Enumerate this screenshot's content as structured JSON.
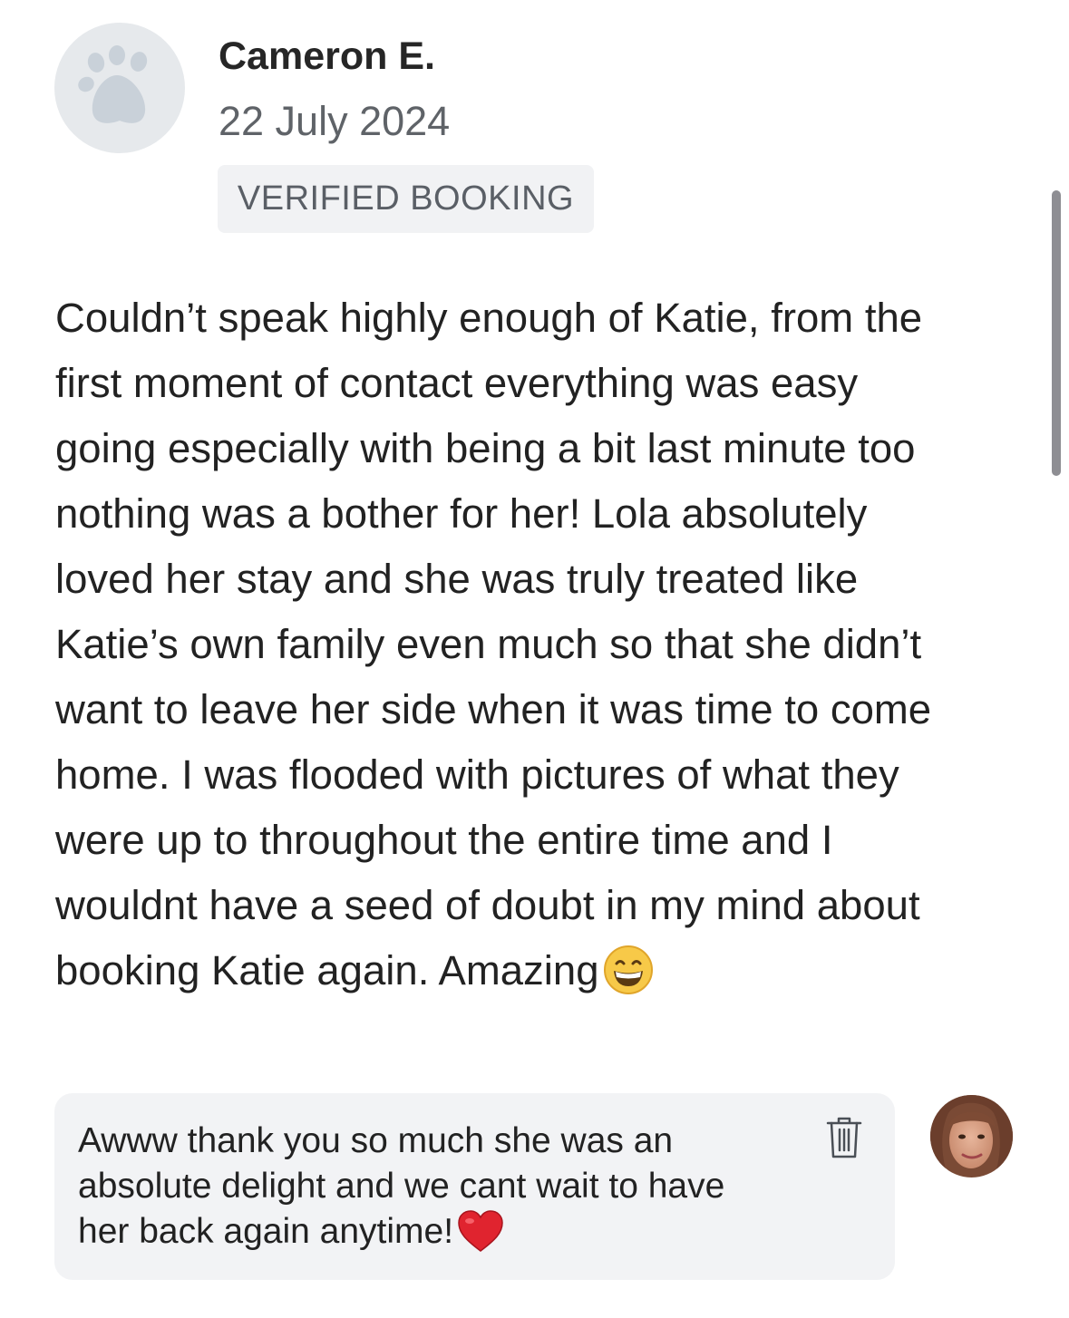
{
  "review": {
    "reviewer_name": "Cameron E.",
    "date": "22 July 2024",
    "badge": "VERIFIED BOOKING",
    "avatar_icon": "paw-icon",
    "body_lines": [
      "Couldn’t speak highly enough of Katie, from the",
      "first moment of contact everything was easy",
      "going especially with being a bit last minute too",
      "nothing was a bother for her! Lola absolutely",
      "loved her stay and she was truly treated like",
      "Katie’s own family even much so that she didn’t",
      "want to leave her side when it was time to come",
      "home. I was flooded with pictures of what they",
      "were up to throughout the entire time and I",
      "wouldnt have a seed of doubt in my mind about",
      "booking Katie again. Amazing"
    ],
    "body_emoji": "grinning-face-emoji"
  },
  "reply": {
    "lines": [
      "Awww thank you so much she was an",
      "absolute delight and we cant wait to have",
      "her back again anytime!"
    ],
    "emoji": "red-heart-emoji",
    "delete_icon": "trash-icon"
  },
  "colors": {
    "avatar_bg": "#e6e9ec",
    "paw": "#c9d1d9",
    "badge_bg": "#f1f2f4",
    "reply_bg": "#f2f3f5",
    "heart": "#e0242f",
    "emoji_face": "#f7c948"
  }
}
